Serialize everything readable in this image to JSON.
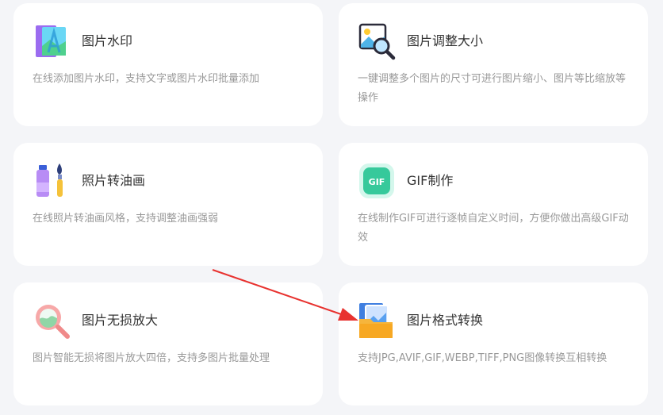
{
  "tools": [
    {
      "icon": "image-watermark-icon",
      "title": "图片水印",
      "description": "在线添加图片水印，支持文字或图片水印批量添加"
    },
    {
      "icon": "image-resize-icon",
      "title": "图片调整大小",
      "description": "一键调整多个图片的尺寸可进行图片缩小、图片等比缩放等操作"
    },
    {
      "icon": "oil-paint-icon",
      "title": "照片转油画",
      "description": "在线照片转油画风格，支持调整油画强弱"
    },
    {
      "icon": "gif-icon",
      "title": "GIF制作",
      "description": "在线制作GIF可进行逐帧自定义时间，方便你做出高级GIF动效",
      "icon_text": "GIF"
    },
    {
      "icon": "magnifier-enlarge-icon",
      "title": "图片无损放大",
      "description": "图片智能无损将图片放大四倍，支持多图片批量处理"
    },
    {
      "icon": "format-convert-folder-icon",
      "title": "图片格式转换",
      "description": "支持JPG,AVIF,GIF,WEBP,TIFF,PNG图像转换互相转换"
    }
  ],
  "colors": {
    "background": "#f4f5f8",
    "card": "#ffffff",
    "title": "#333333",
    "description": "#999999",
    "arrow": "#e8322f"
  }
}
